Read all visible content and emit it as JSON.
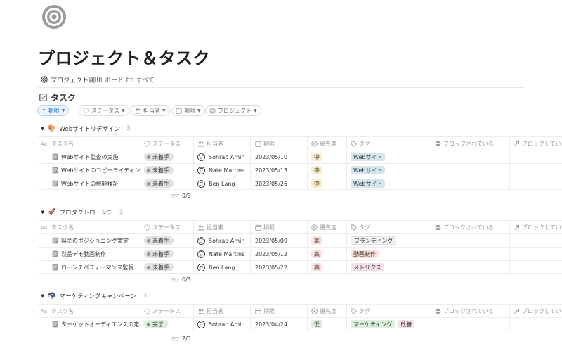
{
  "page": {
    "icon": "target-icon",
    "title": "プロジェクト＆タスク"
  },
  "tabs": [
    {
      "label": "プロジェクト別",
      "icon": "target-icon"
    },
    {
      "label": "ボード",
      "icon": "board-icon"
    },
    {
      "label": "すべて",
      "icon": "table-icon"
    }
  ],
  "database": {
    "title": "タスク",
    "icon": "checkbox-icon"
  },
  "filters": {
    "sort_label": "期限",
    "chips": [
      "ステータス",
      "担当者",
      "期限",
      "プロジェクト"
    ]
  },
  "columns": {
    "name": "タスク名",
    "status": "ステータス",
    "owner": "担当者",
    "date": "期限",
    "priority": "優先度",
    "tag": "タグ",
    "blocked_by": "ブロックされている",
    "blocking": "ブロックしてい"
  },
  "calc_label": "完了",
  "colors": {
    "accent": "#2b7ad0",
    "status_todo": "#e3e2e0",
    "status_done": "#dbeddb",
    "priority_mid": "#fdecc8",
    "priority_high": "#ffe2dd",
    "priority_low": "#dbeddb"
  },
  "groups": [
    {
      "name": "Webサイトリデザイン",
      "emoji": "🎨",
      "count": "3",
      "progress": "0/3",
      "rows": [
        {
          "name": "Webサイト監査の実施",
          "status": "未着手",
          "owner": "Sohrab Amin",
          "date": "2023/05/10",
          "priority": "中",
          "tags": [
            "Webサイト"
          ]
        },
        {
          "name": "Webサイトのコピーライティング",
          "status": "未着手",
          "owner": "Nate Martins",
          "date": "2023/05/13",
          "priority": "中",
          "tags": [
            "Webサイト"
          ]
        },
        {
          "name": "Webサイトの機能検証",
          "status": "未着手",
          "owner": "Ben Lang",
          "date": "2023/05/26",
          "priority": "中",
          "tags": [
            "Webサイト"
          ]
        }
      ]
    },
    {
      "name": "プロダクトローンチ",
      "emoji": "🚀",
      "count": "3",
      "progress": "0/3",
      "rows": [
        {
          "name": "製品のポジショニング策定",
          "status": "未着手",
          "owner": "Sohrab Amin",
          "date": "2023/05/09",
          "priority": "高",
          "tags": [
            "ブランディング"
          ]
        },
        {
          "name": "製品デモ動画制作",
          "status": "未着手",
          "owner": "Nate Martins",
          "date": "2023/05/12",
          "priority": "高",
          "tags": [
            "動画制作"
          ]
        },
        {
          "name": "ローンチパフォーマンス監視",
          "status": "未着手",
          "owner": "Ben Lang",
          "date": "2023/05/22",
          "priority": "高",
          "tags": [
            "メトリクス"
          ]
        }
      ]
    },
    {
      "name": "マーケティングキャンペーン",
      "emoji": "📬",
      "count": "3",
      "progress": "2/3",
      "rows": [
        {
          "name": "ターゲットオーディエンスの定義",
          "status": "完了",
          "owner": "Sohrab Amin",
          "date": "2023/04/24",
          "priority": "低",
          "tags": [
            "マーケティング",
            "改善"
          ]
        }
      ]
    }
  ]
}
